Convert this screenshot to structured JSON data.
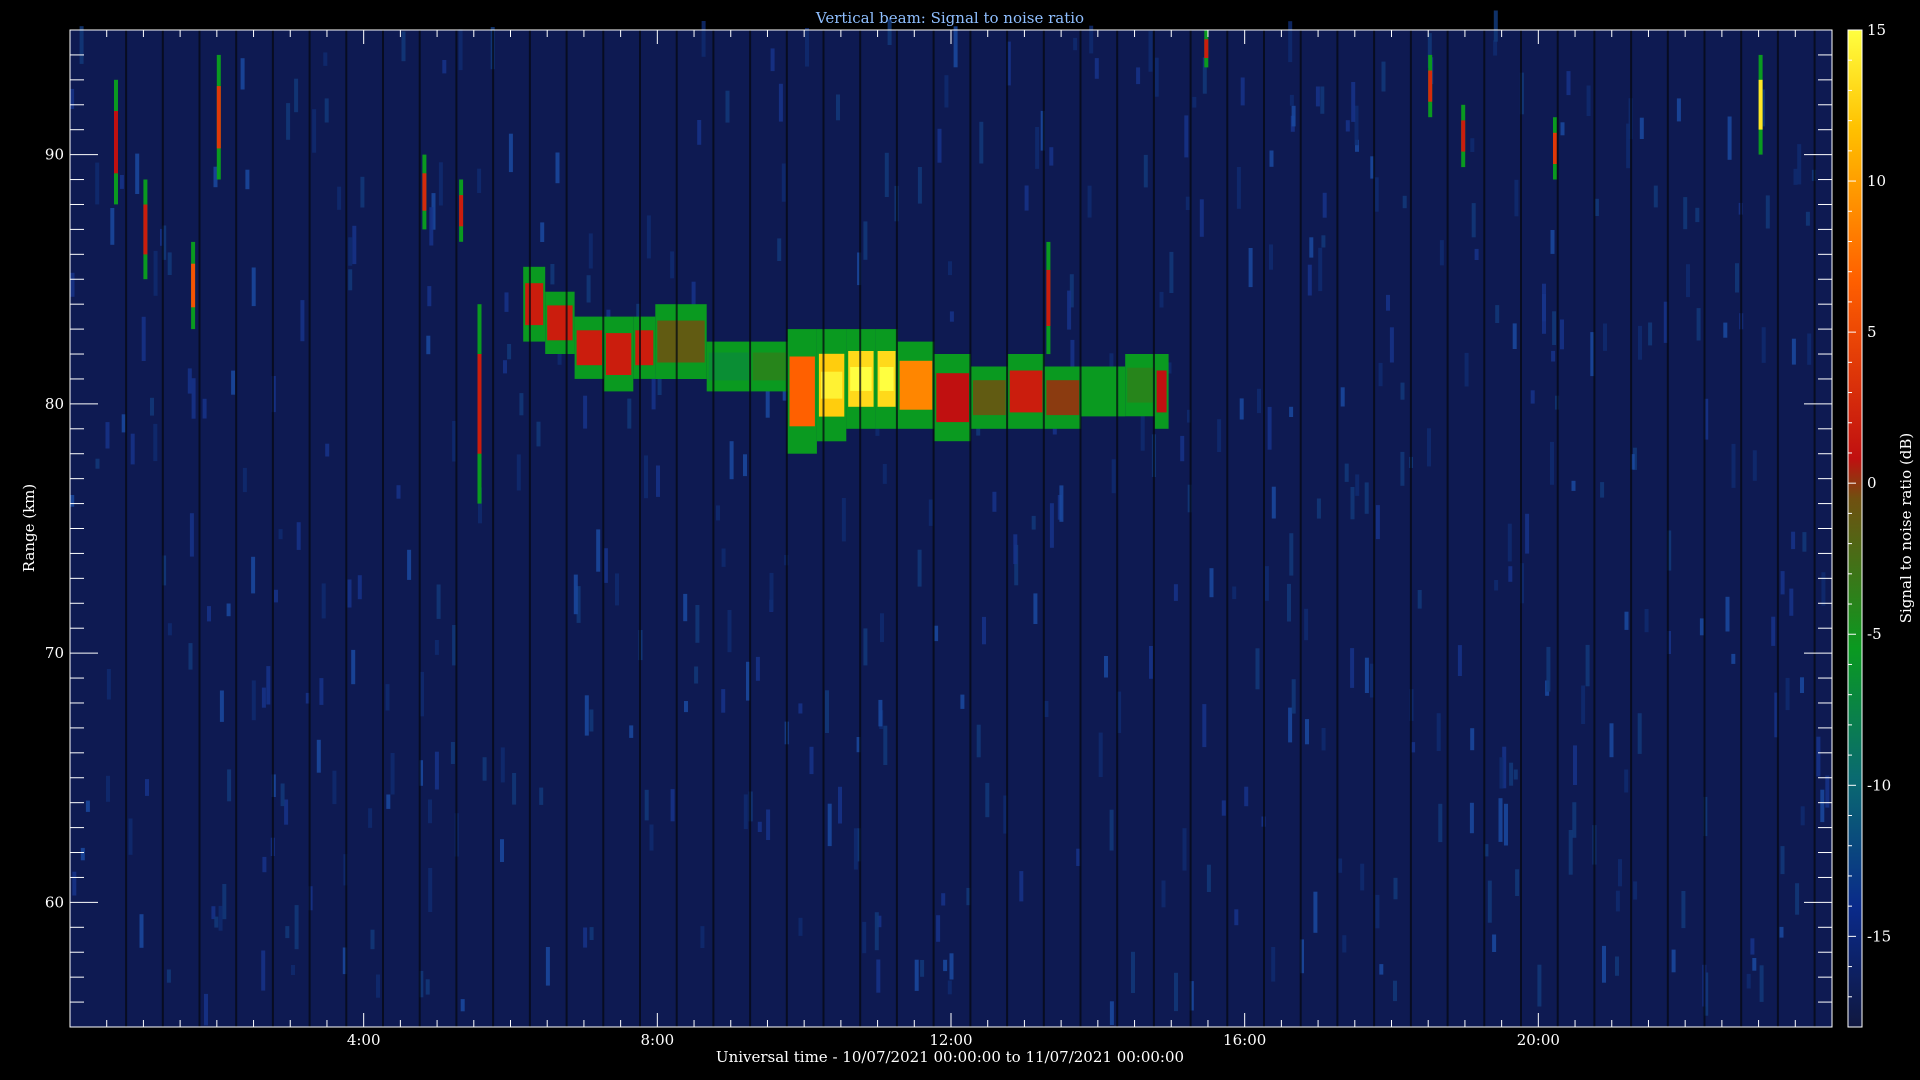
{
  "chart_data": {
    "type": "heatmap",
    "title": "Vertical beam: Signal to noise ratio",
    "xlabel": "Universal time - 10/07/2021 00:00:00 to 11/07/2021 00:00:00",
    "ylabel": "Range (km)",
    "xlim_hours": [
      0,
      24
    ],
    "ylim_km": [
      55,
      95
    ],
    "x_ticks": [
      {
        "hour": 4,
        "label": "4:00"
      },
      {
        "hour": 8,
        "label": "8:00"
      },
      {
        "hour": 12,
        "label": "12:00"
      },
      {
        "hour": 16,
        "label": "16:00"
      },
      {
        "hour": 20,
        "label": "20:00"
      }
    ],
    "y_ticks": [
      {
        "km": 60,
        "label": "60"
      },
      {
        "km": 70,
        "label": "70"
      },
      {
        "km": 80,
        "label": "80"
      },
      {
        "km": 90,
        "label": "90"
      }
    ],
    "colorbar": {
      "label": "Signal to noise ratio (dB)",
      "range_db": [
        -18,
        15
      ],
      "ticks": [
        {
          "db": 15,
          "label": "15"
        },
        {
          "db": 10,
          "label": "10"
        },
        {
          "db": 5,
          "label": "5"
        },
        {
          "db": 0,
          "label": "0"
        },
        {
          "db": -5,
          "label": "-5"
        },
        {
          "db": -10,
          "label": "-10"
        },
        {
          "db": -15,
          "label": "-15"
        }
      ],
      "colors": [
        "#101840",
        "#0a2a8a",
        "#0a6a70",
        "#0a9a20",
        "#b01818",
        "#e03000",
        "#ff8800",
        "#ffe000",
        "#ffff30"
      ]
    },
    "background_db": -16,
    "echo_layer": [
      {
        "hour": 6.2,
        "range_lo": 82.5,
        "range_hi": 85.5,
        "snr_db": 0
      },
      {
        "hour": 6.5,
        "range_lo": 82.0,
        "range_hi": 84.5,
        "snr_db": 0
      },
      {
        "hour": 6.9,
        "range_lo": 81.0,
        "range_hi": 83.5,
        "snr_db": 0
      },
      {
        "hour": 7.3,
        "range_lo": 80.5,
        "range_hi": 83.5,
        "snr_db": 0
      },
      {
        "hour": 7.7,
        "range_lo": 81.0,
        "range_hi": 83.5,
        "snr_db": 0
      },
      {
        "hour": 8.0,
        "range_lo": 81.0,
        "range_hi": 84.0,
        "snr_db": -3
      },
      {
        "hour": 8.7,
        "range_lo": 80.5,
        "range_hi": 82.5,
        "snr_db": -7
      },
      {
        "hour": 9.3,
        "range_lo": 80.5,
        "range_hi": 82.5,
        "snr_db": -5
      },
      {
        "hour": 9.8,
        "range_lo": 78.0,
        "range_hi": 83.0,
        "snr_db": 5
      },
      {
        "hour": 10.2,
        "range_lo": 78.5,
        "range_hi": 83.0,
        "snr_db": 11
      },
      {
        "hour": 10.6,
        "range_lo": 79.0,
        "range_hi": 83.0,
        "snr_db": 12
      },
      {
        "hour": 11.0,
        "range_lo": 79.0,
        "range_hi": 83.0,
        "snr_db": 12
      },
      {
        "hour": 11.3,
        "range_lo": 79.0,
        "range_hi": 82.5,
        "snr_db": 7
      },
      {
        "hour": 11.8,
        "range_lo": 78.5,
        "range_hi": 82.0,
        "snr_db": -1
      },
      {
        "hour": 12.3,
        "range_lo": 79.0,
        "range_hi": 81.5,
        "snr_db": -3
      },
      {
        "hour": 12.8,
        "range_lo": 79.0,
        "range_hi": 82.0,
        "snr_db": 0
      },
      {
        "hour": 13.3,
        "range_lo": 79.0,
        "range_hi": 81.5,
        "snr_db": -2
      },
      {
        "hour": 13.8,
        "range_lo": 79.5,
        "range_hi": 81.5,
        "snr_db": -6
      },
      {
        "hour": 14.4,
        "range_lo": 79.5,
        "range_hi": 82.0,
        "snr_db": -5
      },
      {
        "hour": 14.8,
        "range_lo": 79.0,
        "range_hi": 82.0,
        "snr_db": -1
      }
    ],
    "echo_spikes": [
      {
        "hour": 0.6,
        "range_lo": 88,
        "range_hi": 93,
        "snr_db": -1
      },
      {
        "hour": 1.0,
        "range_lo": 85,
        "range_hi": 89,
        "snr_db": 0
      },
      {
        "hour": 1.65,
        "range_lo": 83,
        "range_hi": 86.5,
        "snr_db": 4
      },
      {
        "hour": 2.0,
        "range_lo": 89,
        "range_hi": 94,
        "snr_db": 2
      },
      {
        "hour": 4.8,
        "range_lo": 87,
        "range_hi": 90,
        "snr_db": 1
      },
      {
        "hour": 5.3,
        "range_lo": 86.5,
        "range_hi": 89,
        "snr_db": 0
      },
      {
        "hour": 5.55,
        "range_lo": 76,
        "range_hi": 84,
        "snr_db": 0
      },
      {
        "hour": 13.3,
        "range_lo": 82,
        "range_hi": 86.5,
        "snr_db": 0
      },
      {
        "hour": 15.45,
        "range_lo": 93.5,
        "range_hi": 95,
        "snr_db": 0
      },
      {
        "hour": 18.5,
        "range_lo": 91.5,
        "range_hi": 94,
        "snr_db": 1
      },
      {
        "hour": 18.95,
        "range_lo": 89.5,
        "range_hi": 92,
        "snr_db": 0
      },
      {
        "hour": 20.2,
        "range_lo": 89,
        "range_hi": 91.5,
        "snr_db": 2
      },
      {
        "hour": 23.0,
        "range_lo": 90,
        "range_hi": 94,
        "snr_db": 13
      }
    ]
  }
}
